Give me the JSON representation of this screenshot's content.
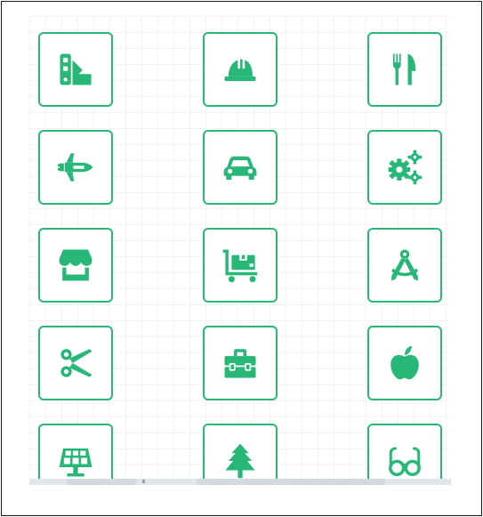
{
  "theme": {
    "accent": "#27b877",
    "grid_line": "#f1f3f5",
    "scrollbar": "#e1e6ea"
  },
  "icon_grid": {
    "tiles": [
      {
        "icon": "swatchbook-icon"
      },
      {
        "icon": "hard-hat-icon"
      },
      {
        "icon": "utensils-icon"
      },
      {
        "icon": "space-shuttle-icon"
      },
      {
        "icon": "car-icon"
      },
      {
        "icon": "gears-icon"
      },
      {
        "icon": "store-icon"
      },
      {
        "icon": "dolly-boxes-icon"
      },
      {
        "icon": "drafting-compass-icon"
      },
      {
        "icon": "scissors-icon"
      },
      {
        "icon": "toolbox-icon"
      },
      {
        "icon": "apple-icon"
      },
      {
        "icon": "solar-panel-icon"
      },
      {
        "icon": "tree-icon"
      },
      {
        "icon": "glasses-icon"
      }
    ]
  }
}
